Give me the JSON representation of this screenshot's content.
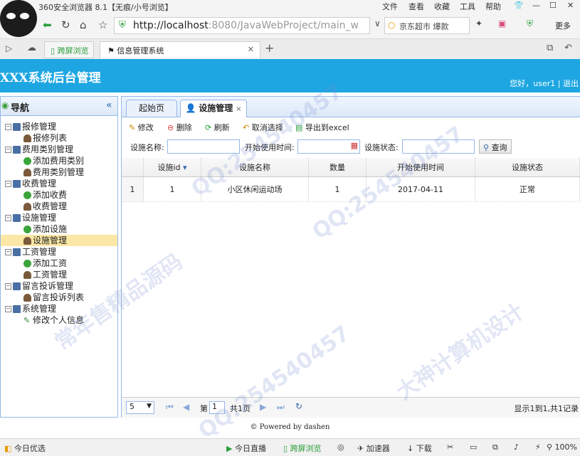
{
  "browser": {
    "title": "360安全浏览器 8.1【无痕/小号浏览】",
    "menu": [
      "文件",
      "查看",
      "收藏",
      "工具",
      "帮助"
    ],
    "url_host": "http://localhost",
    "url_rest": ":8080/JavaWebProject/main_w",
    "search_text": "京东超市 爆款",
    "more_label": "更多",
    "tabs": [
      "跨屏浏览",
      "信息管理系统"
    ],
    "new_tab": "+"
  },
  "app": {
    "title": "XXX系统后台管理",
    "user_greeting": "您好，user1",
    "logout": "退出"
  },
  "sidebar": {
    "header": "导航",
    "collapse": "«",
    "groups": [
      {
        "label": "报修管理",
        "items": [
          "报修列表"
        ]
      },
      {
        "label": "费用类别管理",
        "items": [
          "添加费用类别",
          "费用类别管理"
        ]
      },
      {
        "label": "收费管理",
        "items": [
          "添加收费",
          "收费管理"
        ]
      },
      {
        "label": "设施管理",
        "items": [
          "添加设施",
          "设施管理"
        ]
      },
      {
        "label": "工资管理",
        "items": [
          "添加工资",
          "工资管理"
        ]
      },
      {
        "label": "留言投诉管理",
        "items": [
          "留言投诉列表"
        ]
      },
      {
        "label": "系统管理",
        "items": [
          "修改个人信息"
        ]
      }
    ]
  },
  "main": {
    "tabs": [
      "起始页",
      "设施管理"
    ],
    "toolbar": [
      "修改",
      "删除",
      "刷新",
      "取消选择",
      "导出到excel"
    ],
    "filter": {
      "name_label": "设施名称:",
      "date_label": "开始使用时间:",
      "status_label": "设施状态:",
      "query_button": "查询"
    },
    "table": {
      "columns": [
        "设施id",
        "设施名称",
        "数量",
        "开始使用时间",
        "设施状态"
      ],
      "rows": [
        {
          "idx": "1",
          "id": "1",
          "name": "小区休闲运动场",
          "qty": "1",
          "date": "2017-04-11",
          "status": "正常"
        }
      ]
    },
    "pager": {
      "page_size": "5",
      "page_prefix": "第",
      "page_value": "1",
      "page_suffix": "共1页",
      "summary": "显示1到1,共1记录"
    }
  },
  "footer": "© Powered by dashen",
  "statusbar": {
    "left": "今日优选",
    "live": "今日直播",
    "cross": "跨屏浏览",
    "accel": "加速器",
    "download": "下载",
    "zoom": "100%"
  },
  "colors": {
    "header_bg": "#1ea6e2",
    "selected_row": "#fbe8a6",
    "border": "#95b8e7"
  },
  "watermark": [
    "QQ:254540457",
    "大神计算机设计",
    "常年售精品源码"
  ]
}
